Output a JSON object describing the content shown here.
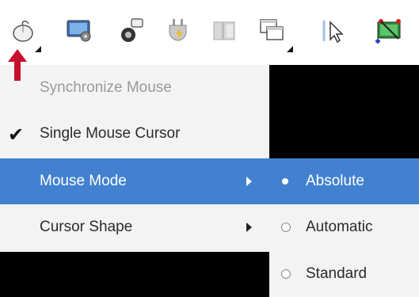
{
  "toolbar": {
    "icons": [
      {
        "name": "mouse-icon"
      },
      {
        "name": "display-settings-icon"
      },
      {
        "name": "usb-device-icon"
      },
      {
        "name": "power-plug-icon"
      },
      {
        "name": "screen-panel-icon"
      },
      {
        "name": "windows-icon"
      },
      {
        "name": "pointer-icon"
      },
      {
        "name": "monitor-connect-icon"
      }
    ]
  },
  "menu": {
    "items": [
      {
        "label": "Synchronize Mouse",
        "state": "disabled"
      },
      {
        "label": "Single Mouse Cursor",
        "checked": true
      },
      {
        "label": "Mouse Mode",
        "state": "highlighted",
        "has_submenu": true
      },
      {
        "label": "Cursor Shape",
        "has_submenu": true
      }
    ]
  },
  "submenu": {
    "items": [
      {
        "label": "Absolute",
        "selected": true
      },
      {
        "label": "Automatic",
        "selected": false
      },
      {
        "label": "Standard",
        "selected": false
      }
    ]
  },
  "colors": {
    "highlight": "#4281cf",
    "menu_bg": "#f3f3f3",
    "annotation_arrow": "#c8102e"
  }
}
